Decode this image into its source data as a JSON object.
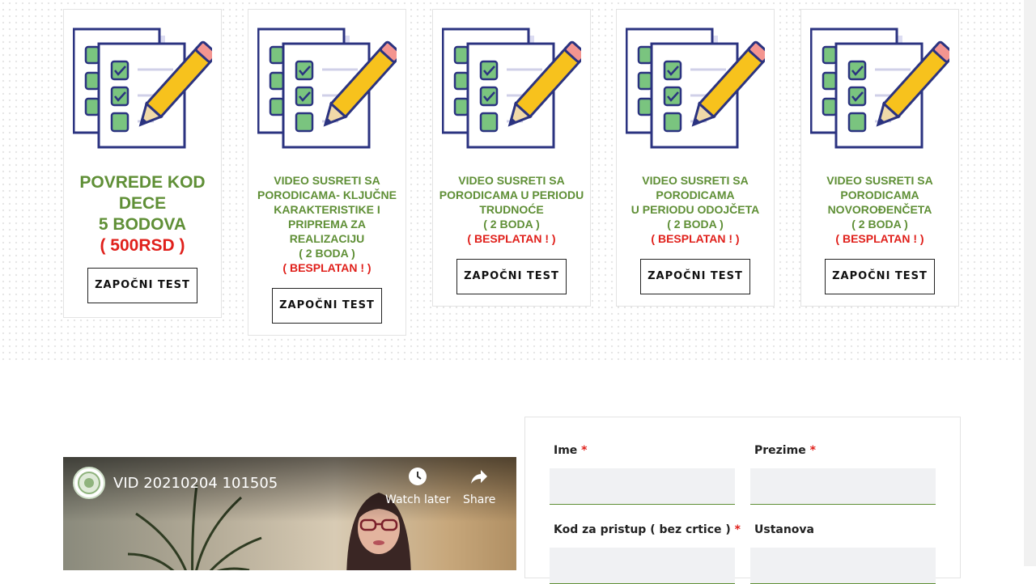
{
  "cards": [
    {
      "title_lines": [
        "POVREDE KOD",
        "DECE",
        "5 BODOVA"
      ],
      "price": "( 500RSD )",
      "button": "ZAPOČNI TEST"
    },
    {
      "title_lines": [
        "VIDEO SUSRETI SA",
        "PORODICAMA- KLJUČNE",
        "KARAKTERISTIKE I",
        "PRIPREMA ZA",
        "REALIZACIJU",
        "( 2 BODA )"
      ],
      "price": "( BESPLATAN ! )",
      "button": "ZAPOČNI TEST"
    },
    {
      "title_lines": [
        "VIDEO SUSRETI SA",
        "PORODICAMA U PERIODU",
        "TRUDNOĆE",
        "( 2 BODA )"
      ],
      "price": "( BESPLATAN ! )",
      "button": "ZAPOČNI TEST"
    },
    {
      "title_lines": [
        "VIDEO SUSRETI SA",
        "PORODICAMA",
        "U PERIODU ODOJČETA",
        "( 2 BODA )"
      ],
      "price": "( BESPLATAN ! )",
      "button": "ZAPOČNI TEST"
    },
    {
      "title_lines": [
        "VIDEO SUSRETI SA",
        "PORODICAMA",
        "NOVOROĐENČETA",
        "( 2 BODA )"
      ],
      "price": "( BESPLATAN ! )",
      "button": "ZAPOČNI TEST"
    }
  ],
  "video": {
    "title": "VID 20210204 101505",
    "watch_later": "Watch later",
    "share": "Share"
  },
  "form": {
    "first_name_label": "Ime",
    "last_name_label": "Prezime",
    "code_label": "Kod za pristup ( bez crtice )",
    "institution_label": "Ustanova",
    "required_mark": "*"
  },
  "colors": {
    "title_green": "#5f8f36",
    "price_red": "#e0201b",
    "checkbox_green": "#7ac47f",
    "pencil_yellow": "#f7c21d",
    "outline_navy": "#2b3380"
  }
}
